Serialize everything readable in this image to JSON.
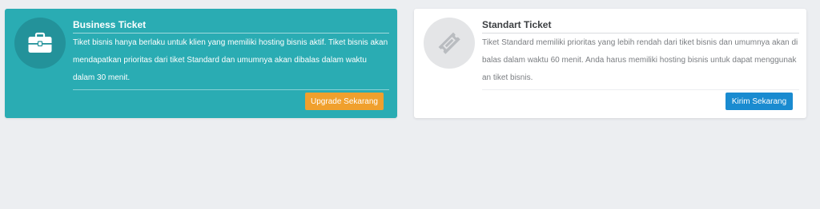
{
  "cards": [
    {
      "title": "Business Ticket",
      "description": "Tiket bisnis hanya berlaku untuk klien yang memiliki hosting bisnis aktif. Tiket bisnis akan mendapatkan prioritas dari tiket Standard dan umumnya akan dibalas dalam waktu dalam 30 menit.",
      "button_label": "Upgrade Sekarang",
      "icon": "briefcase-icon",
      "background_color": "#2aacb3",
      "button_color": "#f0a02d"
    },
    {
      "title": "Standart Ticket",
      "description": "Tiket Standard memiliki prioritas yang lebih rendah dari tiket bisnis dan umumnya akan dibalas dalam waktu 60 menit. Anda harus memiliki hosting bisnis untuk dapat menggunakan tiket bisnis.",
      "button_label": "Kirim Sekarang",
      "icon": "ticket-icon",
      "background_color": "#ffffff",
      "button_color": "#1a8bd0"
    }
  ]
}
